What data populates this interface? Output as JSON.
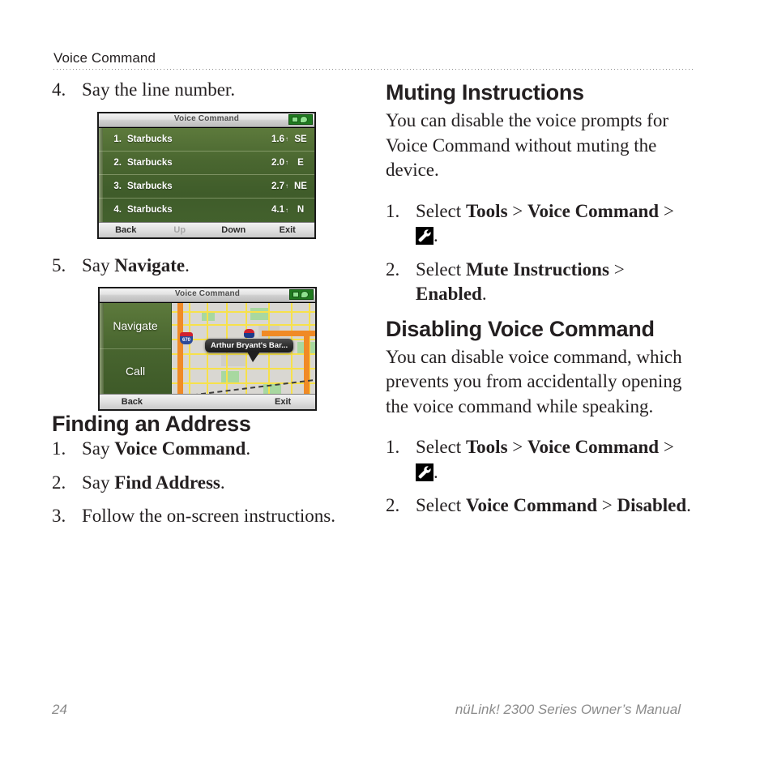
{
  "header": {
    "title": "Voice Command"
  },
  "left_column": {
    "steps_continued": [
      {
        "num": "4.",
        "text": "Say the line number."
      },
      {
        "num": "5.",
        "pre": "Say ",
        "bold": "Navigate",
        "post": "."
      }
    ],
    "screenshot_list": {
      "titlebar": "Voice Command",
      "rows": [
        {
          "num": "1.",
          "name": "Starbucks",
          "distance": "1.6",
          "arrow": "↑",
          "direction": "SE"
        },
        {
          "num": "2.",
          "name": "Starbucks",
          "distance": "2.0",
          "arrow": "↑",
          "direction": "E"
        },
        {
          "num": "3.",
          "name": "Starbucks",
          "distance": "2.7",
          "arrow": "↑",
          "direction": "NE"
        },
        {
          "num": "4.",
          "name": "Starbucks",
          "distance": "4.1",
          "arrow": "↑",
          "direction": "N"
        }
      ],
      "buttons": [
        "Back",
        "Up",
        "Down",
        "Exit"
      ],
      "dimmed_button": "Up"
    },
    "screenshot_map": {
      "titlebar": "Voice Command",
      "option_navigate": "Navigate",
      "option_call": "Call",
      "callout": "Arthur Bryant's Bar...",
      "shield_number": "670",
      "buttons": [
        "Back",
        "Exit"
      ]
    },
    "finding_heading": "Finding an Address",
    "finding_steps": [
      {
        "num": "1.",
        "pre": "Say ",
        "bold": "Voice Command",
        "post": "."
      },
      {
        "num": "2.",
        "pre": "Say ",
        "bold": "Find Address",
        "post": "."
      },
      {
        "num": "3.",
        "pre": "Follow the on-screen instructions.",
        "bold": "",
        "post": ""
      }
    ]
  },
  "right_column": {
    "muting_heading": "Muting Instructions",
    "muting_paragraph": "You can disable the voice prompts for Voice Command without muting the device.",
    "muting_steps": [
      {
        "num": "1.",
        "pre": "Select ",
        "bold1": "Tools",
        "sep1": " > ",
        "bold2": "Voice Command",
        "sep2": " > ",
        "icon": "wrench-icon",
        "post": "."
      },
      {
        "num": "2.",
        "pre": "Select ",
        "bold1": "Mute Instructions",
        "sep1": " > ",
        "bold2": "Enabled",
        "sep2": "",
        "post": "."
      }
    ],
    "disabling_heading": "Disabling Voice Command",
    "disabling_paragraph": "You can disable voice command, which prevents you from accidentally opening the voice command while speaking.",
    "disabling_steps": [
      {
        "num": "1.",
        "pre": "Select ",
        "bold1": "Tools",
        "sep1": " > ",
        "bold2": "Voice Command",
        "sep2": " > ",
        "icon": "wrench-icon",
        "post": "."
      },
      {
        "num": "2.",
        "pre": "Select ",
        "bold1": "Voice Command",
        "sep1": " > ",
        "bold2": "Disabled",
        "sep2": "",
        "post": "."
      }
    ]
  },
  "footer": {
    "page_number": "24",
    "manual_title": "nüLink! 2300 Series Owner’s Manual"
  },
  "colors": {
    "text": "#231f20",
    "footer_text": "#8b8b8b",
    "device_green": "#4a6730",
    "highway_orange": "#f08a26",
    "street_yellow": "#f7e14a",
    "park_green": "#a8d8a0"
  }
}
